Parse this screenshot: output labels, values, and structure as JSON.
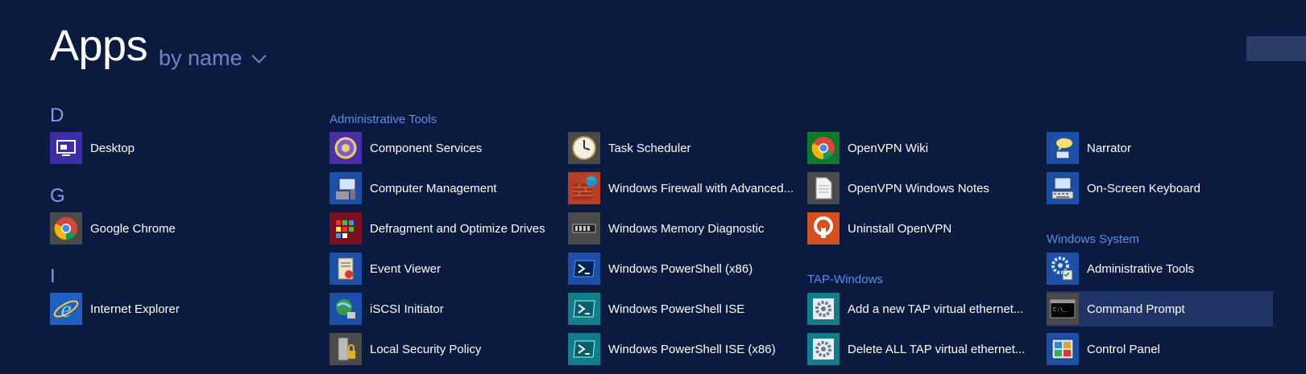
{
  "header": {
    "title": "Apps",
    "sort_label": "by name"
  },
  "letters": {
    "d": "D",
    "g": "G",
    "i": "I"
  },
  "groups": {
    "admin_tools": "Administrative Tools",
    "tap_windows": "TAP-Windows",
    "windows_system": "Windows System"
  },
  "apps": {
    "desktop": "Desktop",
    "chrome": "Google Chrome",
    "ie": "Internet Explorer",
    "component_services": "Component Services",
    "computer_management": "Computer Management",
    "defragment": "Defragment and Optimize Drives",
    "event_viewer": "Event Viewer",
    "iscsi": "iSCSI Initiator",
    "local_security": "Local Security Policy",
    "task_scheduler": "Task Scheduler",
    "firewall": "Windows Firewall with Advanced...",
    "memory_diag": "Windows Memory Diagnostic",
    "ps_x86": "Windows PowerShell (x86)",
    "ps_ise": "Windows PowerShell ISE",
    "ps_ise_x86": "Windows PowerShell ISE (x86)",
    "openvpn_wiki": "OpenVPN Wiki",
    "openvpn_notes": "OpenVPN Windows Notes",
    "uninstall_openvpn": "Uninstall OpenVPN",
    "add_tap": "Add a new TAP virtual ethernet...",
    "delete_tap": "Delete ALL TAP virtual ethernet...",
    "narrator": "Narrator",
    "osk": "On-Screen Keyboard",
    "admin_tools_app": "Administrative Tools",
    "cmd": "Command Prompt",
    "control_panel": "Control Panel"
  },
  "colors": {
    "background": "#0b1a3f",
    "accent_text": "#5c8eea",
    "selected_bg": "#1f3366"
  }
}
